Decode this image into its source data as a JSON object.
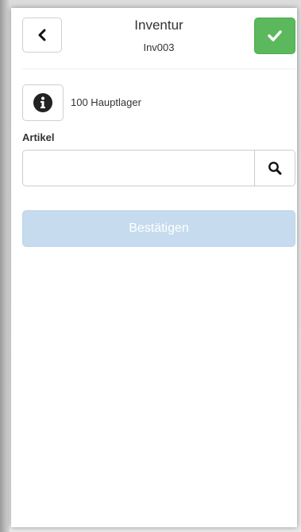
{
  "header": {
    "title": "Inventur",
    "subtitle": "Inv003",
    "back_icon": "chevron-left-icon",
    "confirm_icon": "check-icon"
  },
  "location": {
    "info_icon": "info-circle-icon",
    "warehouse": "100 Hauptlager"
  },
  "article": {
    "label": "Artikel",
    "value": "",
    "placeholder": "",
    "search_icon": "search-icon"
  },
  "actions": {
    "confirm_label": "Bestätigen"
  },
  "colors": {
    "ok_green": "#5cb85c",
    "confirm_disabled": "#c6dcee"
  }
}
